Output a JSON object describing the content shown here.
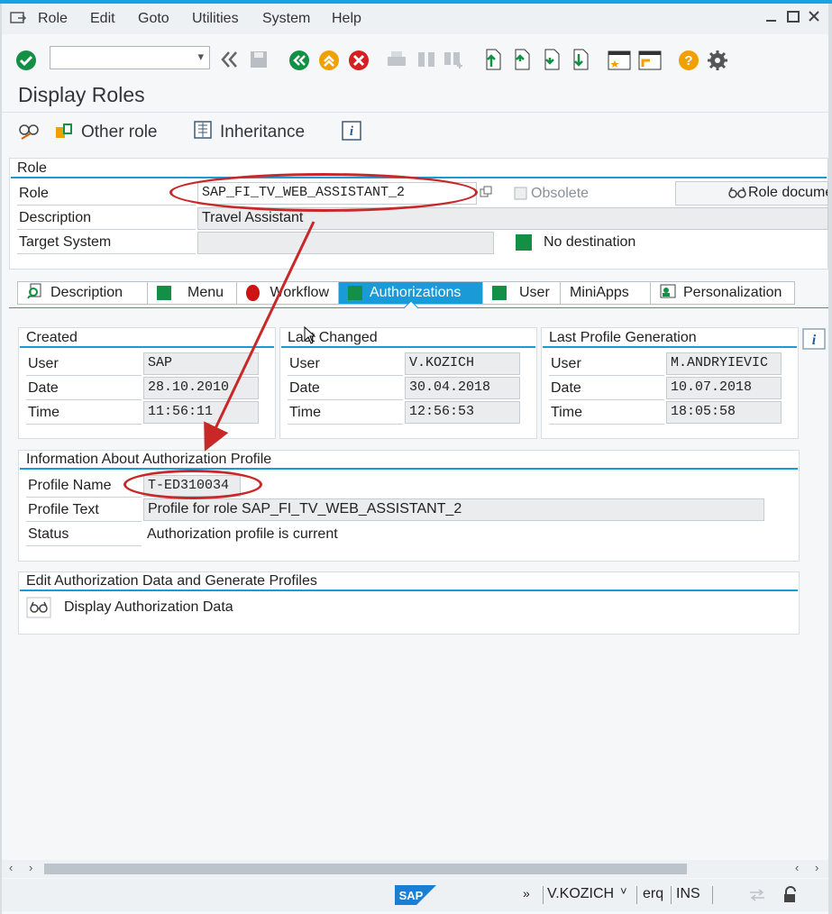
{
  "menu": {
    "items": [
      "Role",
      "Edit",
      "Goto",
      "Utilities",
      "System",
      "Help"
    ]
  },
  "toolbar": {
    "command_field_value": ""
  },
  "page_title": "Display Roles",
  "app_toolbar": {
    "other_role": "Other role",
    "inheritance": "Inheritance",
    "info": "i"
  },
  "role_group": {
    "title": "Role",
    "role_label": "Role",
    "role_value": "SAP_FI_TV_WEB_ASSISTANT_2",
    "obsolete_label": "Obsolete",
    "role_doc_label": "Role docume",
    "description_label": "Description",
    "description_value": "Travel Assistant",
    "target_label": "Target System",
    "target_value": "",
    "no_destination": "No destination"
  },
  "tabs": [
    "Description",
    "Menu",
    "Workflow",
    "Authorizations",
    "User",
    "MiniApps",
    "Personalization"
  ],
  "active_tab": "Authorizations",
  "created": {
    "title": "Created",
    "user_label": "User",
    "user": "SAP",
    "date_label": "Date",
    "date": "28.10.2010",
    "time_label": "Time",
    "time": "11:56:11"
  },
  "last_changed": {
    "title": "Last Changed",
    "user_label": "User",
    "user": "V.KOZICH",
    "date_label": "Date",
    "date": "30.04.2018",
    "time_label": "Time",
    "time": "12:56:53"
  },
  "last_generation": {
    "title": "Last Profile Generation",
    "user_label": "User",
    "user": "M.ANDRYIEVIC",
    "date_label": "Date",
    "date": "10.07.2018",
    "time_label": "Time",
    "time": "18:05:58"
  },
  "auth_profile": {
    "title": "Information About Authorization Profile",
    "name_label": "Profile Name",
    "name": "T-ED310034",
    "text_label": "Profile Text",
    "text": "Profile for role SAP_FI_TV_WEB_ASSISTANT_2",
    "status_label": "Status",
    "status": "Authorization profile is current"
  },
  "edit_auth": {
    "title": "Edit Authorization Data and Generate Profiles",
    "display_button": "Display Authorization Data"
  },
  "statusbar": {
    "user": "V.KOZICH",
    "client": "erq",
    "mode": "INS",
    "sap_logo": "SAP"
  },
  "colors": {
    "accent": "#1a9ad6",
    "annotation": "#c82828",
    "status_green": "#139046"
  }
}
